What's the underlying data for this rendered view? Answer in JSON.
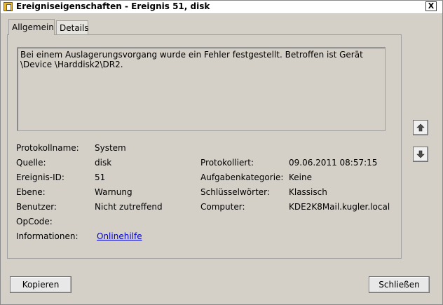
{
  "window": {
    "title": "Ereigniseigenschaften - Ereignis 51, disk",
    "close_glyph": "X"
  },
  "tabs": [
    {
      "label": "Allgemein"
    },
    {
      "label": "Details"
    }
  ],
  "message": "Bei einem Auslagerungsvorgang wurde ein Fehler festgestellt. Betroffen ist Gerät \\Device \\Harddisk2\\DR2.",
  "fields": {
    "protokollname": {
      "label": "Protokollname:",
      "value": "System"
    },
    "quelle": {
      "label": "Quelle:",
      "value": "disk"
    },
    "protokolliert": {
      "label": "Protokolliert:",
      "value": "09.06.2011 08:57:15"
    },
    "ereignis_id": {
      "label": "Ereignis-ID:",
      "value": "51"
    },
    "aufgabenkategorie": {
      "label": "Aufgabenkategorie:",
      "value": "Keine"
    },
    "ebene": {
      "label": "Ebene:",
      "value": "Warnung"
    },
    "schluesselwoerter": {
      "label": "Schlüsselwörter:",
      "value": "Klassisch"
    },
    "benutzer": {
      "label": "Benutzer:",
      "value": "Nicht zutreffend"
    },
    "computer": {
      "label": "Computer:",
      "value": "KDE2K8Mail.kugler.local"
    },
    "opcode": {
      "label": "OpCode:",
      "value": ""
    },
    "informationen": {
      "label": "Informationen:",
      "link": "Onlinehilfe"
    }
  },
  "buttons": {
    "copy": "Kopieren",
    "close": "Schließen"
  },
  "icons": {
    "up": "arrow-up-icon",
    "down": "arrow-down-icon"
  },
  "colors": {
    "link": "#0000cc",
    "dialog_bg": "#d4d0c8"
  }
}
